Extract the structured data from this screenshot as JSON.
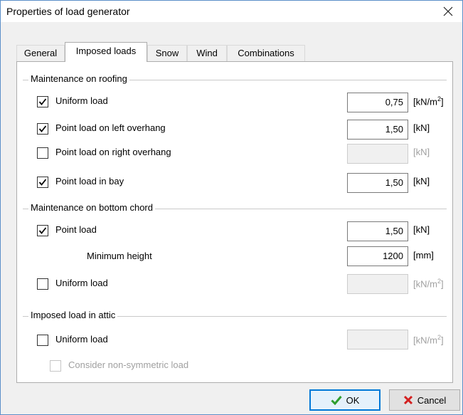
{
  "dialog": {
    "title": "Properties of load generator"
  },
  "tabs": [
    {
      "label": "General"
    },
    {
      "label": "Imposed loads"
    },
    {
      "label": "Snow"
    },
    {
      "label": "Wind"
    },
    {
      "label": "Combinations"
    }
  ],
  "groups": {
    "roofing": "Maintenance on roofing",
    "bottom_chord": "Maintenance on bottom chord",
    "attic": "Imposed load in attic"
  },
  "rows": {
    "uniform_roof": {
      "label": "Uniform load",
      "checked": true,
      "value": "0,75",
      "unit": "[kN/m",
      "unit_sup": "2",
      "unit_end": "]"
    },
    "point_left": {
      "label": "Point load on left overhang",
      "checked": true,
      "value": "1,50",
      "unit": "[kN]"
    },
    "point_right": {
      "label": "Point load on right overhang",
      "checked": false,
      "value": "",
      "unit": "[kN]"
    },
    "point_bay": {
      "label": "Point load in bay",
      "checked": true,
      "value": "1,50",
      "unit": "[kN]"
    },
    "point_chord": {
      "label": "Point load",
      "checked": true,
      "value": "1,50",
      "unit": "[kN]"
    },
    "min_height": {
      "label": "Minimum height",
      "value": "1200",
      "unit": "[mm]"
    },
    "uniform_chord": {
      "label": "Uniform load",
      "checked": false,
      "value": "",
      "unit": "[kN/m",
      "unit_sup": "2",
      "unit_end": "]"
    },
    "uniform_attic": {
      "label": "Uniform load",
      "checked": false,
      "value": "",
      "unit": "[kN/m",
      "unit_sup": "2",
      "unit_end": "]"
    },
    "non_symmetric": {
      "label": "Consider non-symmetric load",
      "checked": false
    }
  },
  "buttons": {
    "ok": "OK",
    "cancel": "Cancel"
  },
  "colors": {
    "ok_check": "#2e9e2e",
    "cancel_x": "#d32020",
    "default_border": "#0078d7"
  }
}
